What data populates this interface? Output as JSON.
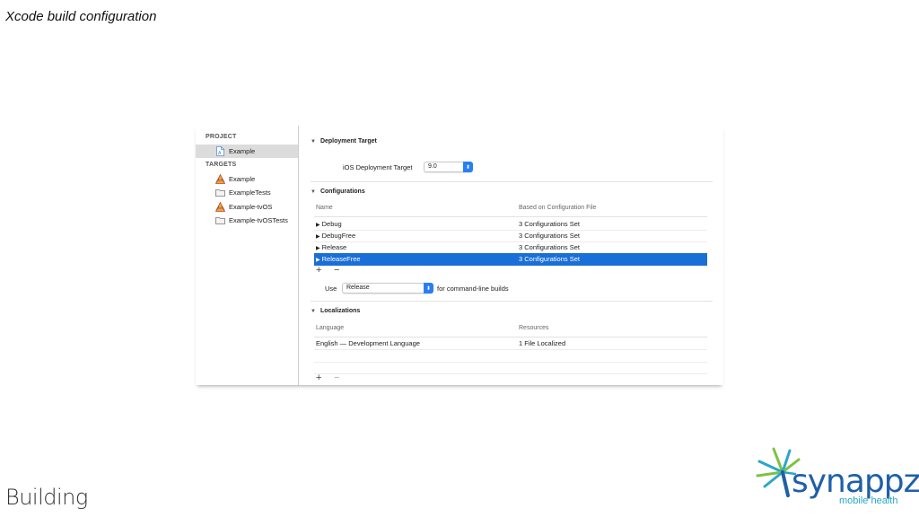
{
  "slide": {
    "title": "Xcode build configuration",
    "footer": "Building"
  },
  "sidebar": {
    "project_header": "PROJECT",
    "project_item": "Example",
    "targets_header": "TARGETS",
    "targets": [
      "Example",
      "ExampleTests",
      "Example-tvOS",
      "Example-tvOSTests"
    ]
  },
  "deployment": {
    "header": "Deployment Target",
    "label": "iOS Deployment Target",
    "value": "9.0"
  },
  "configurations": {
    "header": "Configurations",
    "col_name": "Name",
    "col_file": "Based on Configuration File",
    "rows": [
      {
        "name": "Debug",
        "file": "3 Configurations Set"
      },
      {
        "name": "DebugFree",
        "file": "3 Configurations Set"
      },
      {
        "name": "Release",
        "file": "3 Configurations Set"
      },
      {
        "name": "ReleaseFree",
        "file": "3 Configurations Set"
      }
    ],
    "add": "+",
    "remove": "−",
    "use_label": "Use",
    "use_value": "Release",
    "use_suffix": "for command-line builds"
  },
  "localizations": {
    "header": "Localizations",
    "col_language": "Language",
    "col_resources": "Resources",
    "rows": [
      {
        "language": "English — Development Language",
        "resources": "1 File Localized"
      }
    ],
    "add": "+",
    "remove": "−"
  },
  "logo": {
    "word": "synappz",
    "tagline": "mobile health"
  },
  "colors": {
    "selection": "#1a6ed8",
    "popup_accent": "#2a7ef5",
    "logo_blue": "#1f5fa8",
    "logo_teal": "#2aa7c9",
    "logo_green": "#7cc242"
  }
}
